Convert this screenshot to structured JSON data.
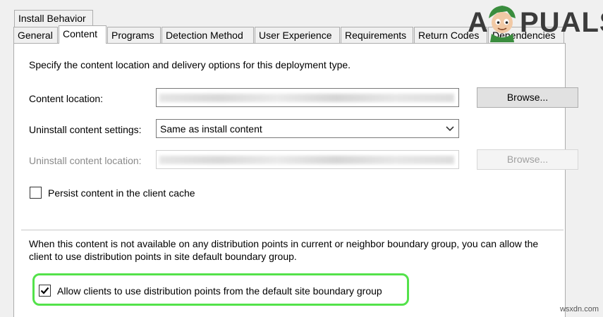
{
  "dialog": {
    "upper_tab": "Install Behavior",
    "tabs": [
      "General",
      "Content",
      "Programs",
      "Detection Method",
      "User Experience",
      "Requirements",
      "Return Codes",
      "Dependencies"
    ],
    "active_tab": "Content"
  },
  "content": {
    "description": "Specify the content location and delivery options for this deployment type.",
    "content_location_label": "Content location:",
    "browse_label": "Browse...",
    "uninstall_settings_label": "Uninstall content settings:",
    "uninstall_settings_value": "Same as install content",
    "uninstall_location_label": "Uninstall content location:",
    "browse_disabled_label": "Browse...",
    "persist_label": "Persist content in the client cache",
    "persist_checked": false,
    "fallback_text_1": "When this content is not available on any distribution points in current or neighbor boundary group, you can allow the",
    "fallback_text_2": "client to use distribution points in site default boundary group.",
    "allow_label": "Allow clients to use distribution points from the default site boundary group",
    "allow_checked": true
  },
  "watermark": {
    "logo_text": "APPUALS",
    "site": "wsxdn.com"
  },
  "colors": {
    "highlight": "#53e24a",
    "logo_green": "#3a8d3e"
  }
}
